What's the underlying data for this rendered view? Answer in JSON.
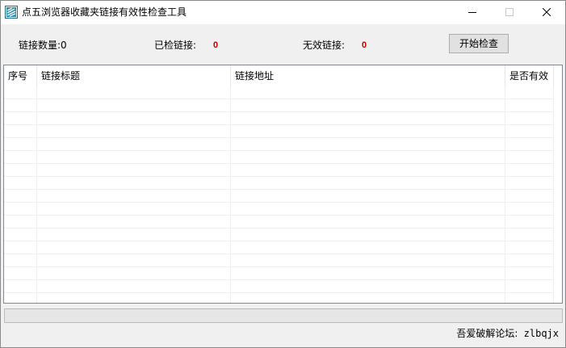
{
  "window": {
    "title": "点五浏览器收藏夹链接有效性检查工具",
    "app_icon": "app-logo-icon",
    "controls": {
      "minimize_icon": "minimize-icon",
      "maximize_icon": "maximize-icon",
      "close_icon": "close-icon"
    }
  },
  "stats": {
    "link_count_label": "链接数量:0",
    "checked_label": "已检链接:",
    "checked_value": "0",
    "invalid_label": "无效链接:",
    "invalid_value": "0",
    "value_color": "#c00000"
  },
  "toolbar": {
    "start_button_label": "开始检查"
  },
  "table": {
    "columns": [
      "序号",
      "链接标题",
      "链接地址",
      "是否有效"
    ],
    "rows": []
  },
  "progress": {
    "percent": 0
  },
  "footer": {
    "credit_label": "吾爱破解论坛:",
    "credit_user": " zlbqjx"
  }
}
